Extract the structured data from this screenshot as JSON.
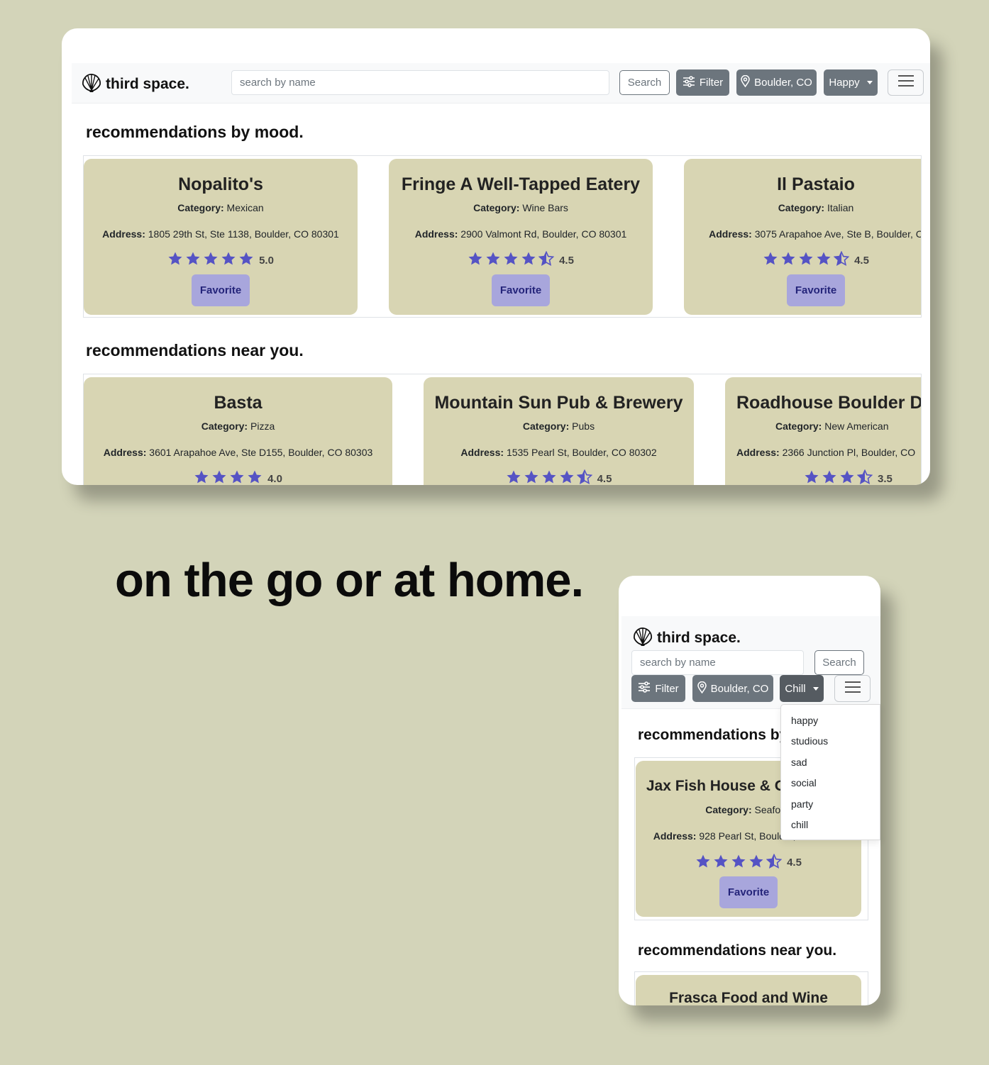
{
  "brand": {
    "name": "third space.",
    "logo_icon": "shell-icon"
  },
  "desktop": {
    "search_placeholder": "search by name",
    "search_button": "Search",
    "filter_button": "Filter",
    "location_button": "Boulder, CO",
    "mood_button": "Happy",
    "mood_section_title": "recommendations by mood.",
    "near_section_title": "recommendations near you.",
    "mood_cards": [
      {
        "title": "Nopalito's",
        "category": "Mexican",
        "address": "1805 29th St, Ste 1138, Boulder, CO 80301",
        "rating": 5.0,
        "rating_text": "5.0",
        "favorite": "Favorite"
      },
      {
        "title": "Fringe A Well-Tapped Eatery",
        "category": "Wine Bars",
        "address": "2900 Valmont Rd, Boulder, CO 80301",
        "rating": 4.5,
        "rating_text": "4.5",
        "favorite": "Favorite"
      },
      {
        "title": "Il Pastaio",
        "category": "Italian",
        "address": "3075 Arapahoe Ave, Ste B, Boulder, C",
        "rating": 4.5,
        "rating_text": "4.5",
        "favorite": "Favorite"
      }
    ],
    "near_cards": [
      {
        "title": "Basta",
        "category": "Pizza",
        "address": "3601 Arapahoe Ave, Ste D155, Boulder, CO 80303",
        "rating": 4.0,
        "rating_text": "4.0"
      },
      {
        "title": "Mountain Sun Pub & Brewery",
        "category": "Pubs",
        "address": "1535 Pearl St, Boulder, CO 80302",
        "rating": 4.5,
        "rating_text": "4.5"
      },
      {
        "title": "Roadhouse Boulder D",
        "category": "New American",
        "address": "2366 Junction Pl, Boulder, CO",
        "rating": 3.5,
        "rating_text": "3.5"
      }
    ]
  },
  "labels": {
    "category": "Category:",
    "address": "Address:"
  },
  "tagline": "on the go or at home.",
  "mobile": {
    "search_placeholder": "search by name",
    "search_button": "Search",
    "filter_button": "Filter",
    "location_button": "Boulder, CO",
    "mood_button": "Chill",
    "mood_section_title": "recommendations by mood.",
    "near_section_title": "recommendations near you.",
    "mood_card": {
      "title": "Jax Fish House & Oyster Bar",
      "category": "Seafood",
      "address": "928 Pearl St, Boulder, CO 80302",
      "rating": 4.5,
      "rating_text": "4.5",
      "favorite": "Favorite"
    },
    "near_card": {
      "title": "Frasca Food and Wine"
    },
    "mood_options": [
      "happy",
      "studious",
      "sad",
      "social",
      "party",
      "chill"
    ]
  },
  "colors": {
    "background": "#d3d4b9",
    "card": "#d8d5b3",
    "star": "#5553c4",
    "favorite_button": "#a8a6dc"
  }
}
